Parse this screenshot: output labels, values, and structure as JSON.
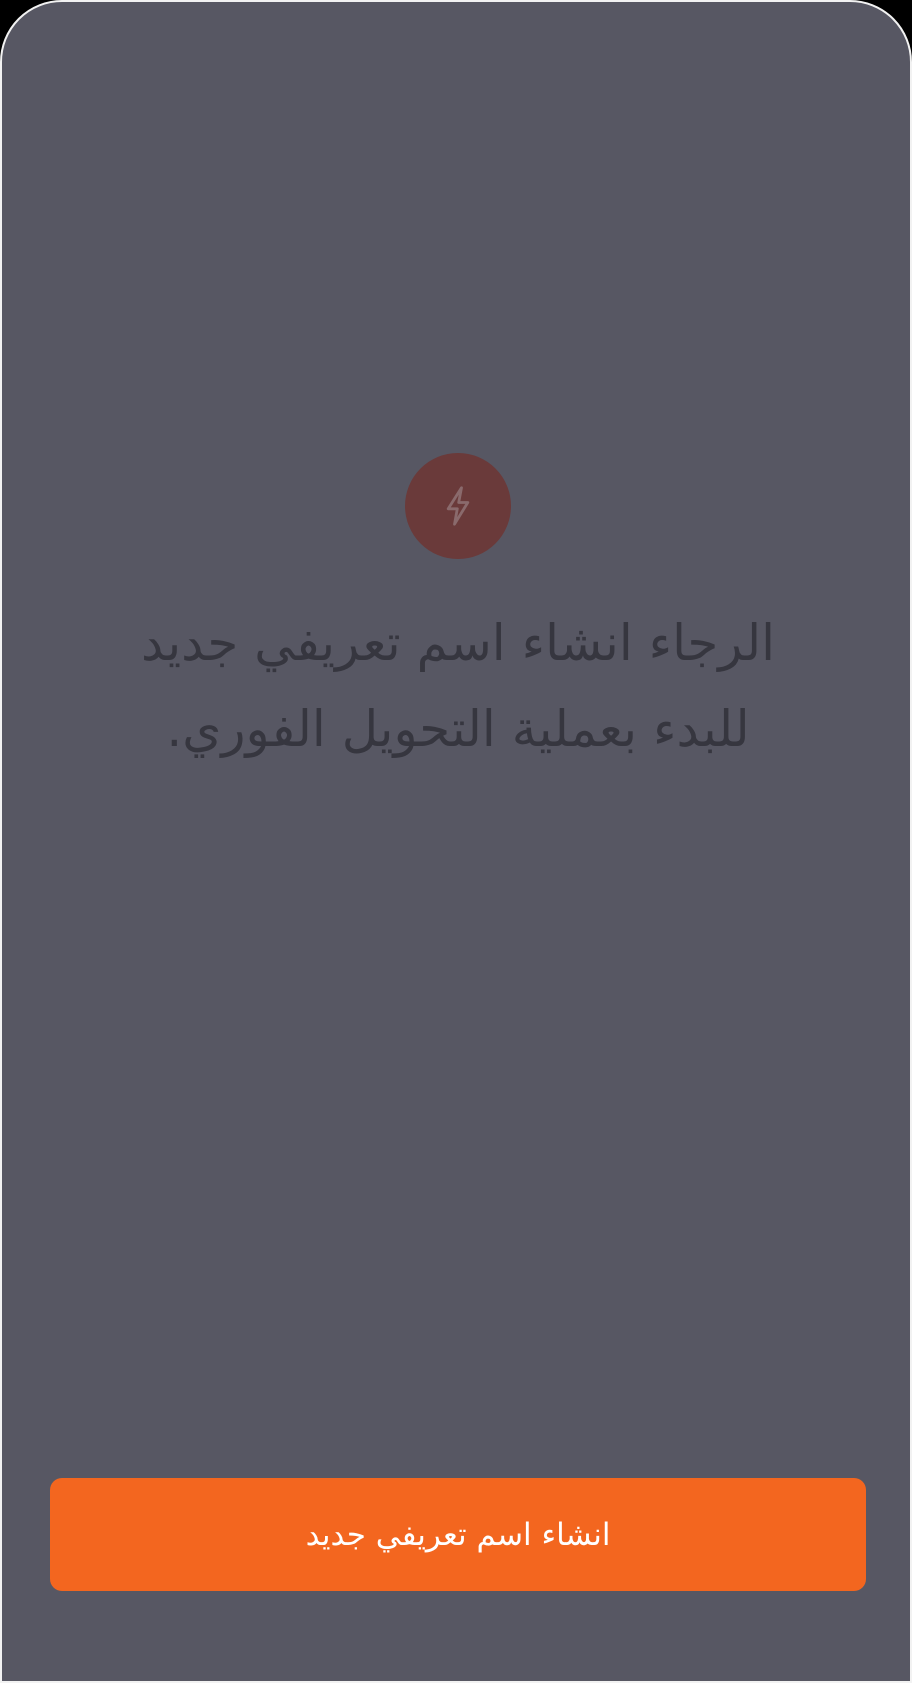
{
  "empty_state": {
    "icon": "lightning-bolt-icon",
    "icon_circle_color": "#6a3a3a",
    "message": "الرجاء انشاء اسم تعريفي جديد للبدء بعملية التحويل الفوري."
  },
  "primary_action": {
    "label": "انشاء اسم تعريفي جديد",
    "color": "#f3661f"
  },
  "colors": {
    "background": "#575763",
    "text": "#36363f"
  }
}
